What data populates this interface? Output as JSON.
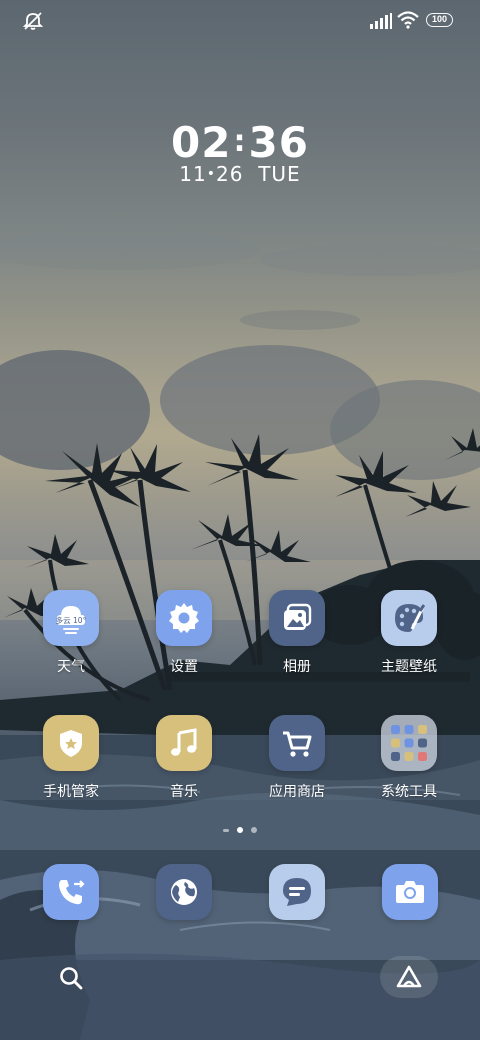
{
  "status_bar": {
    "battery": "100",
    "icons": [
      "mute-icon",
      "signal-icon",
      "wifi-icon",
      "battery-icon"
    ]
  },
  "clock": {
    "hours": "02",
    "minutes": "36",
    "date": "11",
    "date_day": "26",
    "weekday": "TUE"
  },
  "apps": [
    {
      "label": "天气",
      "icon": "weather-icon",
      "badge": "多云 10°",
      "color": "#8fb1f0"
    },
    {
      "label": "设置",
      "icon": "gear-icon",
      "color": "#7ea3ec"
    },
    {
      "label": "相册",
      "icon": "gallery-icon",
      "color": "#4f6488"
    },
    {
      "label": "主题壁纸",
      "icon": "palette-icon",
      "color": "#b8ccec"
    },
    {
      "label": "手机管家",
      "icon": "shield-icon",
      "color": "#d6c07c"
    },
    {
      "label": "音乐",
      "icon": "music-note-icon",
      "color": "#d6c07c"
    },
    {
      "label": "应用商店",
      "icon": "cart-icon",
      "color": "#4f6488"
    },
    {
      "label": "系统工具",
      "icon": "folder-icon",
      "color": "#c4ccd6"
    }
  ],
  "dock": [
    {
      "name": "phone",
      "icon": "phone-icon",
      "color": "#7ea3ec"
    },
    {
      "name": "browser",
      "icon": "globe-icon",
      "color": "#4f6488"
    },
    {
      "name": "messages",
      "icon": "message-icon",
      "color": "#b8ccec"
    },
    {
      "name": "camera",
      "icon": "camera-icon",
      "color": "#7ea3ec"
    }
  ],
  "page_indicator": {
    "pages": 3,
    "current": 2
  },
  "bottom": {
    "left_icon": "search-icon",
    "right_icon": "assistant-icon"
  }
}
